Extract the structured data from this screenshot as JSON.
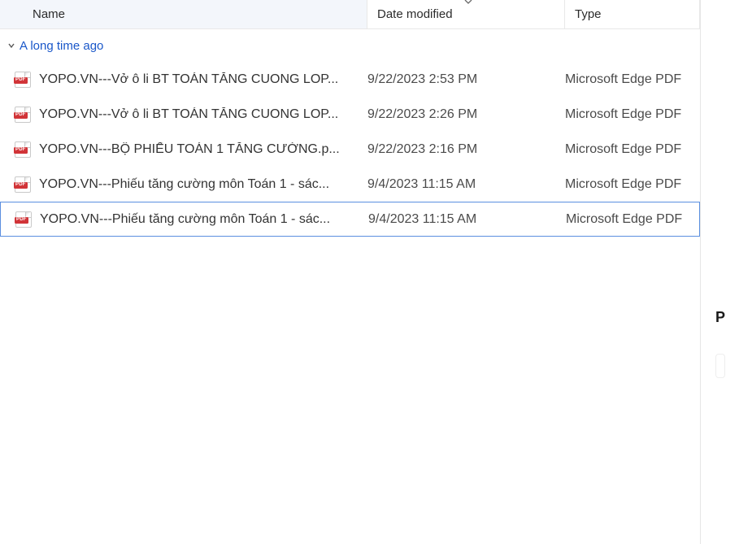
{
  "headers": {
    "name": "Name",
    "date": "Date modified",
    "type": "Type"
  },
  "group": {
    "label": "A long time ago"
  },
  "files": [
    {
      "name": "YOPO.VN---Vở ô li BT TOÁN TĂNG CUONG LOP...",
      "date": "9/22/2023 2:53 PM",
      "type": "Microsoft Edge PDF"
    },
    {
      "name": "YOPO.VN---Vở ô li BT TOÁN TĂNG CUONG LOP...",
      "date": "9/22/2023 2:26 PM",
      "type": "Microsoft Edge PDF"
    },
    {
      "name": "YOPO.VN---BỘ PHIẾU TOÁN 1 TĂNG CƯỜNG.p...",
      "date": "9/22/2023 2:16 PM",
      "type": "Microsoft Edge PDF"
    },
    {
      "name": "YOPO.VN---Phiếu tăng cường môn Toán 1 - sác...",
      "date": "9/4/2023 11:15 AM",
      "type": "Microsoft Edge PDF"
    },
    {
      "name": "YOPO.VN---Phiếu tăng cường môn Toán 1 - sác...",
      "date": "9/4/2023 11:15 AM",
      "type": "Microsoft Edge PDF"
    }
  ],
  "selected_index": 4,
  "side": {
    "letter": "P"
  },
  "icon_badge": "PDF"
}
